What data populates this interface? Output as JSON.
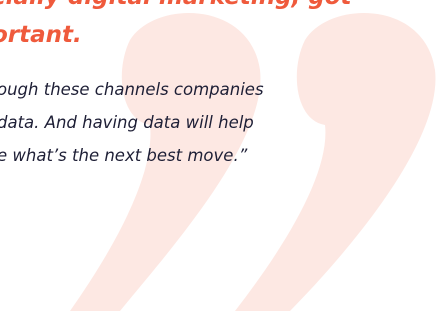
{
  "headline": {
    "line1": "cially digital marketing, got",
    "line2": "ortant."
  },
  "quote": {
    "line1": "ough these channels companies",
    "line2": "data. And having data will help",
    "line3": "e what’s the next best move.”"
  },
  "colors": {
    "accent": "#ef5a3c",
    "quote_mark": "#fde8e3",
    "text": "#1e1f36",
    "background": "#ffffff"
  },
  "icons": {
    "decorative_quote": "closing-quotation-mark-icon"
  }
}
